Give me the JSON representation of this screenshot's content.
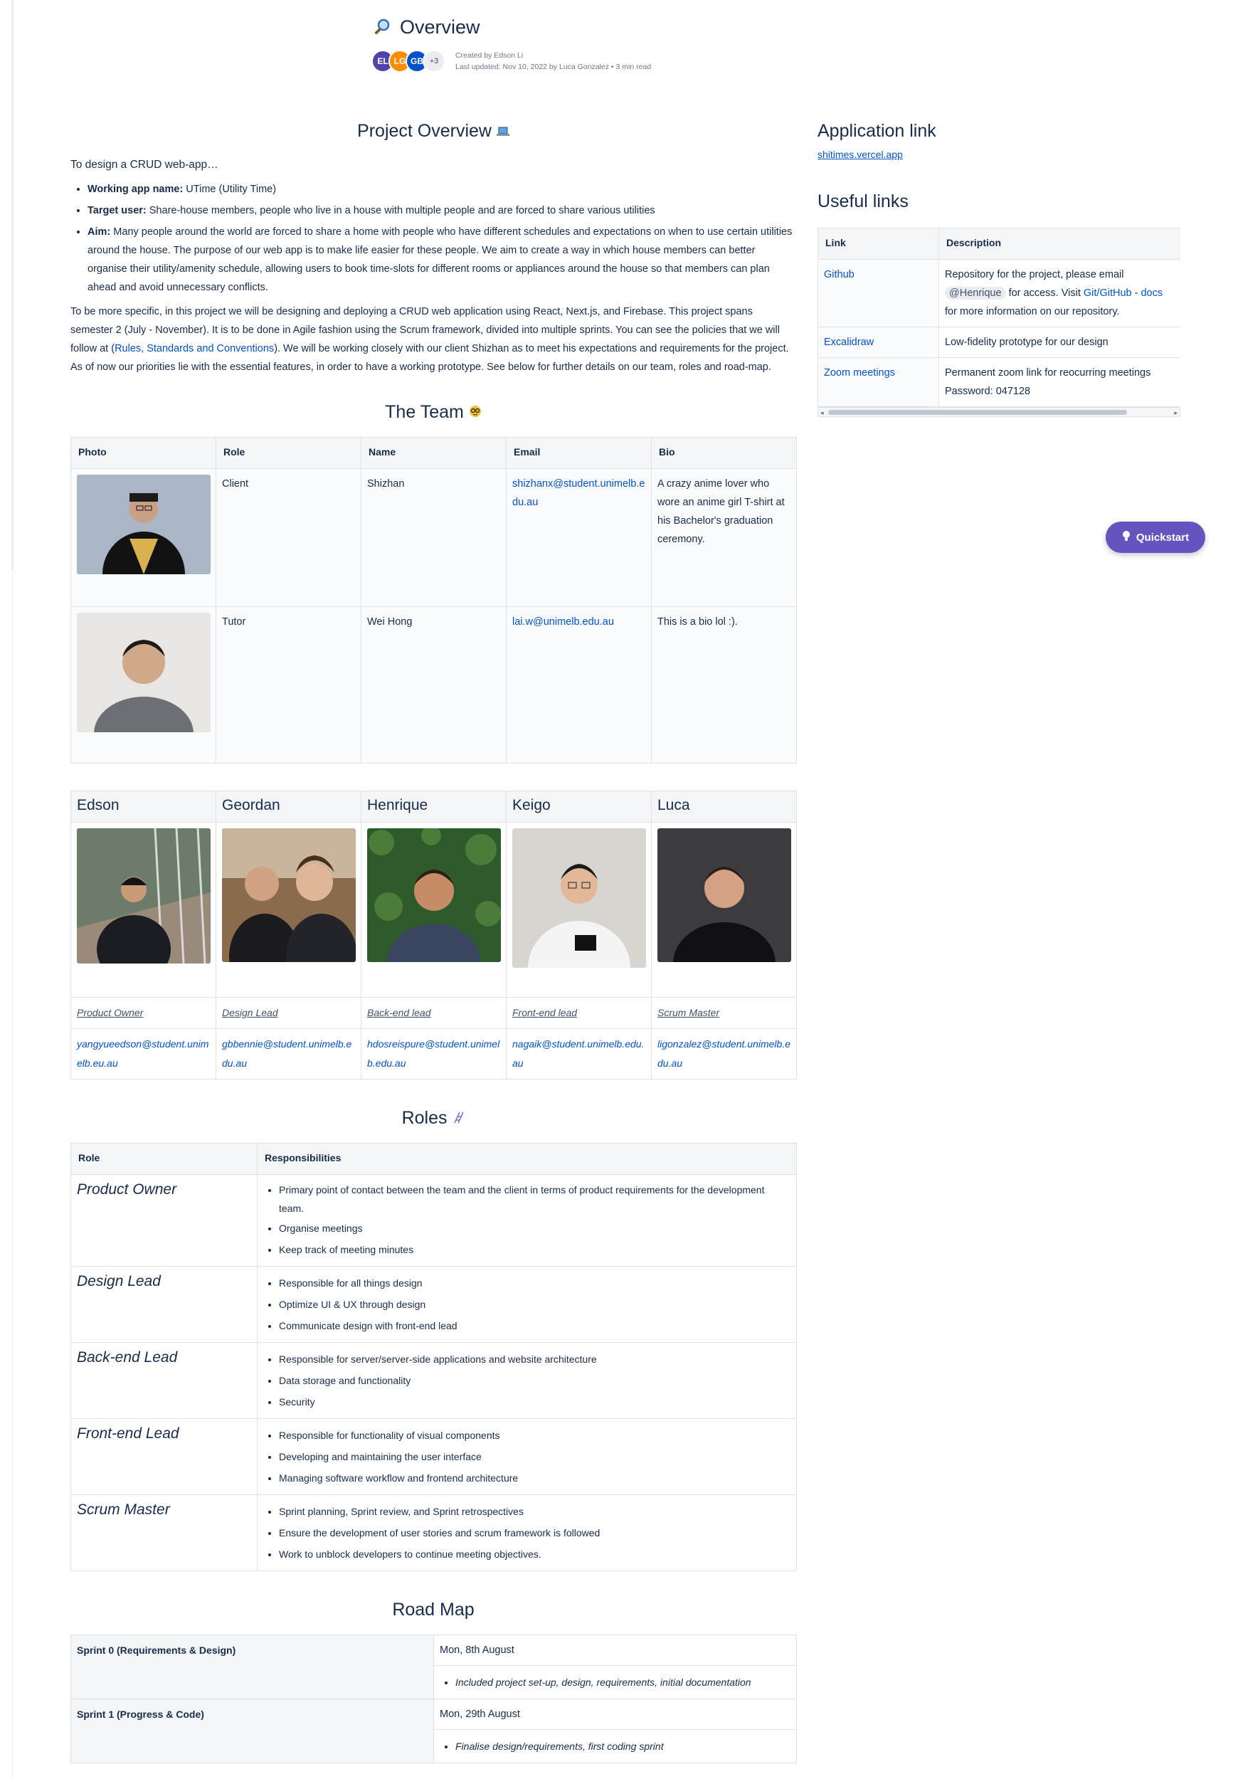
{
  "header": {
    "title": "Overview",
    "avatars": [
      "EL",
      "LG",
      "GB",
      "+3"
    ],
    "created_by": "Created by Edson Li",
    "last_updated": "Last updated: Nov 10, 2022 by Luca Gonzalez •  3 min read"
  },
  "overview": {
    "heading": "Project Overview",
    "intro": "To design a CRUD web-app…",
    "bullets": [
      {
        "label": "Working app name:",
        "text": " UTime (Utility Time)"
      },
      {
        "label": "Target user:",
        "text": " Share-house members, people who live in a house with multiple people and are forced to share various utilities"
      },
      {
        "label": "Aim:",
        "text": " Many people around the world are forced to share a home with people who have different schedules and expectations on when to use certain utilities around the house. The purpose of our web app is to make life easier for these people. We aim to create a way in which house members can better organise their utility/amenity schedule, allowing users to book time-slots for different rooms or appliances around the house so that members can plan ahead and avoid unnecessary conflicts."
      }
    ],
    "para_before_link": "To be more specific, in this project we will be designing and deploying a CRUD web application using React, Next.js, and Firebase. This project spans semester 2 (July - November). It is to be done in Agile fashion using the Scrum framework, divided into multiple sprints. You can see the policies that we will follow at (",
    "para_link": "Rules, Standards and Conventions",
    "para_after_link": "). We will be working closely with our client Shizhan as to meet his expectations and requirements for the project. As of now our priorities lie with the essential features, in order to have a working prototype. See below for further details on our team, roles and road-map."
  },
  "team": {
    "heading": "The Team",
    "columns": [
      "Photo",
      "Role",
      "Name",
      "Email",
      "Bio"
    ],
    "rows": [
      {
        "role": "Client",
        "name": "Shizhan",
        "email": "shizhanx@student.unimelb.edu.au",
        "bio": "A crazy anime lover who wore an anime girl T-shirt at his Bachelor's graduation ceremony."
      },
      {
        "role": "Tutor",
        "name": "Wei Hong",
        "email": "lai.w@unimelb.edu.au",
        "bio": "This is a bio lol :)."
      }
    ]
  },
  "members": [
    {
      "name": "Edson",
      "role": "Product Owner ",
      "email": "yangyueedson@student.unimelb.eu.au"
    },
    {
      "name": "Geordan",
      "role": "Design Lead",
      "email": "gbbennie@student.unimelb.edu.au"
    },
    {
      "name": "Henrique",
      "role": "Back-end lead ",
      "email": "hdosreispure@student.unimelb.edu.au"
    },
    {
      "name": "Keigo",
      "role": "Front-end lead",
      "email": "nagaik@student.unimelb.edu.au"
    },
    {
      "name": "Luca",
      "role": "Scrum Master",
      "email": "ligonzalez@student.unimelb.edu.au"
    }
  ],
  "roles": {
    "heading": "Roles",
    "columns": [
      "Role",
      "Responsibilities"
    ],
    "rows": [
      {
        "role": "Product Owner",
        "items": [
          "Primary point of contact between the team and the client in terms of product requirements for the development team.",
          "Organise meetings",
          "Keep track of meeting minutes"
        ]
      },
      {
        "role": "Design Lead",
        "items": [
          "Responsible for all things design",
          "Optimize UI & UX through design",
          "Communicate design with front-end lead"
        ]
      },
      {
        "role": "Back-end Lead",
        "items": [
          "Responsible for server/server-side applications and website architecture",
          "Data storage and functionality",
          "Security"
        ]
      },
      {
        "role": "Front-end Lead",
        "items": [
          "Responsible for functionality of visual components",
          "Developing and maintaining the user interface",
          "Managing software workflow and frontend architecture"
        ]
      },
      {
        "role": "Scrum Master",
        "items": [
          "Sprint planning, Sprint review, and Sprint retrospectives",
          "Ensure the development of user stories and scrum framework is followed",
          "Work to unblock developers to continue meeting objectives."
        ]
      }
    ]
  },
  "roadmap": {
    "heading": "Road Map",
    "rows": [
      {
        "sprint": "Sprint 0 (Requirements & Design)",
        "date": "Mon, 8th August",
        "note": "Included project set-up, design, requirements, initial documentation"
      },
      {
        "sprint": "Sprint 1 (Progress & Code)",
        "date": "Mon, 29th August",
        "note": "Finalise design/requirements, first coding sprint"
      }
    ]
  },
  "sidebar": {
    "app_heading": "Application link",
    "app_url": "shitimes.vercel.app",
    "links_heading": "Useful links",
    "columns": [
      "Link",
      "Description"
    ],
    "rows": [
      {
        "link": "Github",
        "desc_pre": "Repository for the project, please email ",
        "mention": "@Henrique",
        "desc_mid": " for access. Visit ",
        "desc_link1": "Git/GitHub",
        "desc_sep": " - ",
        "desc_link2": "docs",
        "desc_post": " for more information on our repository."
      },
      {
        "link": "Excalidraw",
        "desc": "Low-fidelity prototype for our design"
      },
      {
        "link": "Zoom meetings",
        "desc": "Permanent zoom link for reocurring meetings",
        "desc2": "Password: 047128"
      }
    ]
  },
  "quickstart": {
    "label": "Quickstart"
  },
  "colors": {
    "brand": "#0052cc",
    "quickstart": "#6554c0",
    "text": "#172b4d"
  }
}
